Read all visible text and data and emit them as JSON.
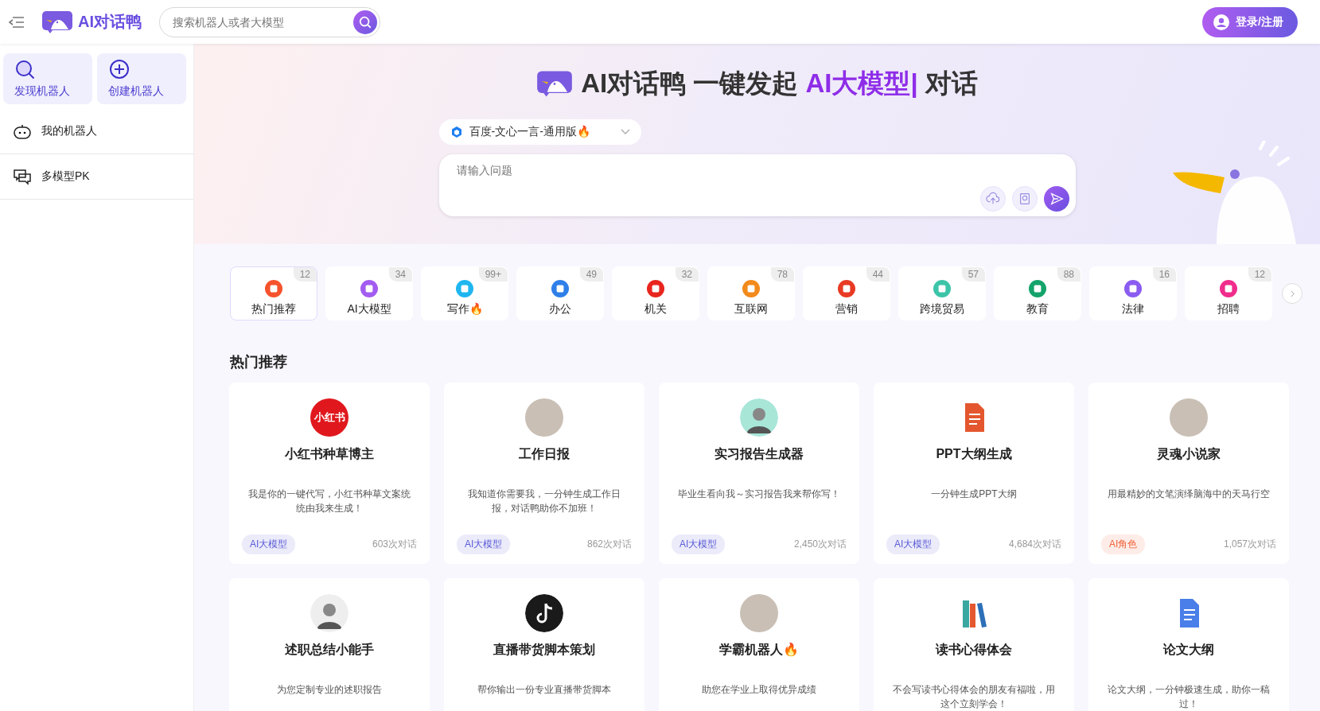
{
  "header": {
    "brand": "AI对话鸭",
    "search": {
      "placeholder": "搜索机器人或者大模型"
    },
    "login": "登录/注册"
  },
  "sidebar": {
    "actions": [
      {
        "label": "发现机器人",
        "kind": "search"
      },
      {
        "label": "创建机器人",
        "kind": "plus"
      }
    ],
    "items": [
      {
        "label": "我的机器人",
        "kind": "robot"
      },
      {
        "label": "多模型PK",
        "kind": "chat"
      }
    ]
  },
  "hero": {
    "title_prefix": "AI对话鸭 一键发起 ",
    "title_highlight": "AI大模型|",
    "title_suffix": " 对话",
    "model": "百度-文心一言-通用版🔥",
    "input": {
      "placeholder": "请输入问题"
    }
  },
  "categories": [
    {
      "label": "热门推荐",
      "count": "12",
      "color": "#f5532d",
      "selected": true
    },
    {
      "label": "AI大模型",
      "count": "34",
      "color": "#a35cf0",
      "selected": false
    },
    {
      "label": "写作🔥",
      "count": "99+",
      "color": "#1fb6f0",
      "selected": false
    },
    {
      "label": "办公",
      "count": "49",
      "color": "#2f7fe8",
      "selected": false
    },
    {
      "label": "机关",
      "count": "32",
      "color": "#e8251e",
      "selected": false
    },
    {
      "label": "互联网",
      "count": "78",
      "color": "#f28a1c",
      "selected": false
    },
    {
      "label": "营销",
      "count": "44",
      "color": "#e83a24",
      "selected": false
    },
    {
      "label": "跨境贸易",
      "count": "57",
      "color": "#3cc4a8",
      "selected": false
    },
    {
      "label": "教育",
      "count": "88",
      "color": "#13a36b",
      "selected": false
    },
    {
      "label": "法律",
      "count": "16",
      "color": "#8b5cf0",
      "selected": false
    },
    {
      "label": "招聘",
      "count": "12",
      "color": "#f02c8c",
      "selected": false
    }
  ],
  "section_title": "热门推荐",
  "cards": [
    {
      "title": "小红书种草博主",
      "desc": "我是你的一键代写，小红书种草文案统统由我来生成！",
      "avatar": {
        "kind": "logo",
        "text": "小红书",
        "color": "#e0181e"
      },
      "tag": {
        "text": "AI大模型",
        "color": "#5b5bd6"
      },
      "count": "603次对话"
    },
    {
      "title": "工作日报",
      "desc": "我知道你需要我，一分钟生成工作日报，对话鸭助你不加班！",
      "avatar": {
        "kind": "photo"
      },
      "tag": {
        "text": "AI大模型",
        "color": "#5b5bd6"
      },
      "count": "862次对话"
    },
    {
      "title": "实习报告生成器",
      "desc": "毕业生看向我～实习报告我来帮你写！",
      "avatar": {
        "kind": "person",
        "color": "#a8e6d8"
      },
      "tag": {
        "text": "AI大模型",
        "color": "#5b5bd6"
      },
      "count": "2,450次对话"
    },
    {
      "title": "PPT大纲生成",
      "desc": "一分钟生成PPT大纲",
      "avatar": {
        "kind": "doc",
        "color": "#e4572e"
      },
      "tag": {
        "text": "AI大模型",
        "color": "#5b5bd6"
      },
      "count": "4,684次对话"
    },
    {
      "title": "灵魂小说家",
      "desc": "用最精妙的文笔演绎脑海中的天马行空",
      "avatar": {
        "kind": "photo"
      },
      "tag": {
        "text": "AI角色",
        "color": "#f0643c"
      },
      "count": "1,057次对话"
    },
    {
      "title": "述职总结小能手",
      "desc": "为您定制专业的述职报告",
      "avatar": {
        "kind": "person",
        "color": "#eeeeee"
      }
    },
    {
      "title": "直播带货脚本策划",
      "desc": "帮你输出一份专业直播带货脚本",
      "avatar": {
        "kind": "note",
        "color": "#1a1a1a"
      }
    },
    {
      "title": "学霸机器人🔥",
      "desc": "助您在学业上取得优异成绩",
      "avatar": {
        "kind": "photo"
      }
    },
    {
      "title": "读书心得体会",
      "desc": "不会写读书心得体会的朋友有福啦，用这个立刻学会！",
      "avatar": {
        "kind": "books",
        "color": "#3aa7a0"
      }
    },
    {
      "title": "论文大纲",
      "desc": "论文大纲，一分钟极速生成，助你一稿过！",
      "avatar": {
        "kind": "doc",
        "color": "#4a7ee8"
      }
    }
  ]
}
